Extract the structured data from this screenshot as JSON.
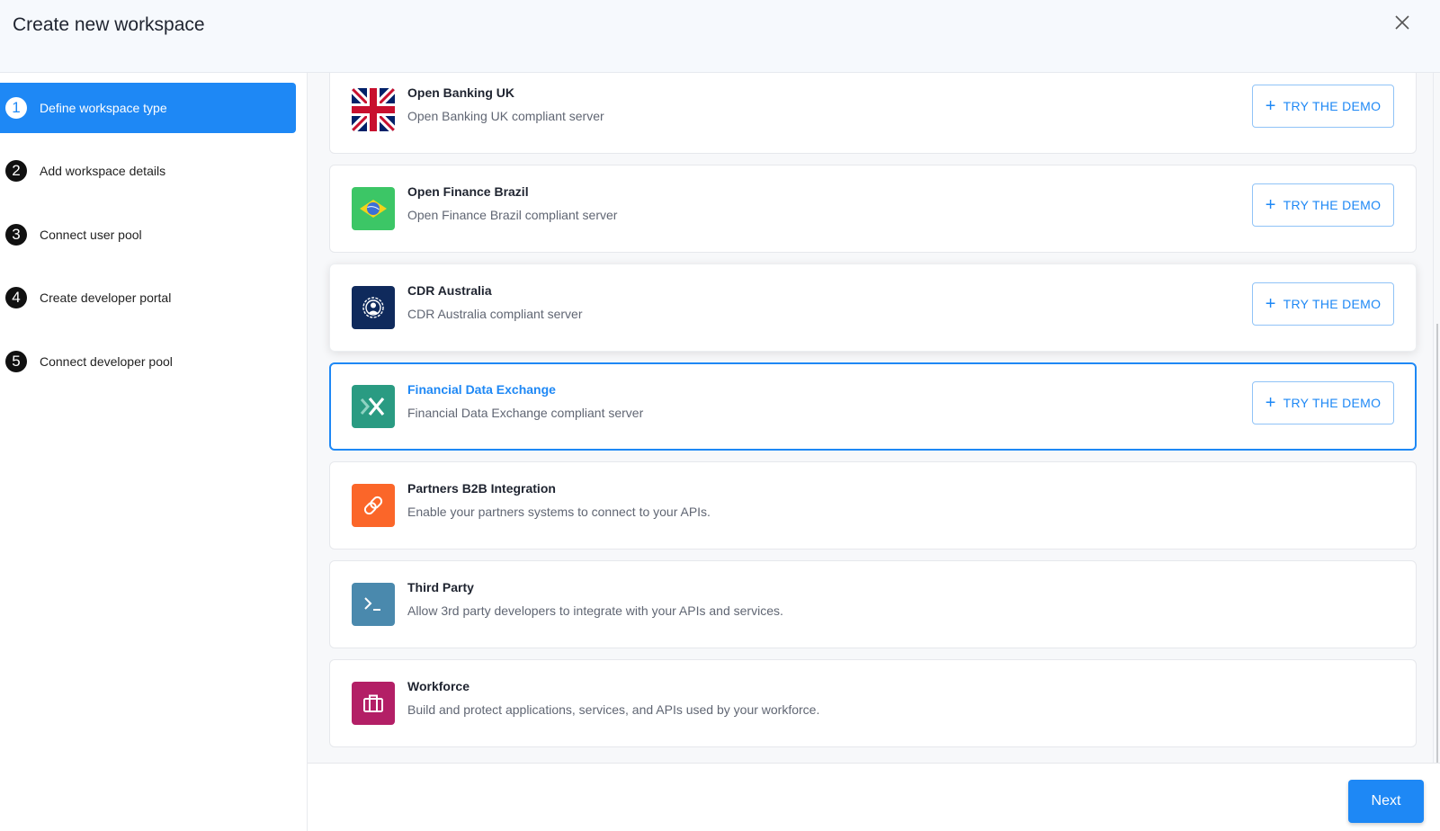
{
  "header": {
    "title": "Create new workspace",
    "close_icon": "close-icon"
  },
  "steps": [
    {
      "number": "1",
      "label": "Define workspace type",
      "active": true
    },
    {
      "number": "2",
      "label": "Add workspace details",
      "active": false
    },
    {
      "number": "3",
      "label": "Connect user pool",
      "active": false
    },
    {
      "number": "4",
      "label": "Create developer portal",
      "active": false
    },
    {
      "number": "5",
      "label": "Connect developer pool",
      "active": false
    }
  ],
  "workspace_types": [
    {
      "name": "Open Banking UK",
      "description": "Open Banking UK compliant server",
      "icon": "uk-flag-icon",
      "demo_label": "TRY THE DEMO",
      "has_demo": true
    },
    {
      "name": "Open Finance Brazil",
      "description": "Open Finance Brazil compliant server",
      "icon": "brazil-flag-icon",
      "demo_label": "TRY THE DEMO",
      "has_demo": true
    },
    {
      "name": "CDR Australia",
      "description": "CDR Australia compliant server",
      "icon": "cdr-australia-icon",
      "demo_label": "TRY THE DEMO",
      "has_demo": true,
      "hovered": true
    },
    {
      "name": "Financial Data Exchange",
      "description": "Financial Data Exchange compliant server",
      "icon": "fdx-icon",
      "demo_label": "TRY THE DEMO",
      "has_demo": true,
      "selected": true
    },
    {
      "name": "Partners B2B Integration",
      "description": "Enable your partners systems to connect to your APIs.",
      "icon": "link-icon",
      "has_demo": false
    },
    {
      "name": "Third Party",
      "description": "Allow 3rd party developers to integrate with your APIs and services.",
      "icon": "terminal-icon",
      "has_demo": false
    },
    {
      "name": "Workforce",
      "description": "Build and protect applications, services, and APIs used by your workforce.",
      "icon": "briefcase-icon",
      "has_demo": false
    }
  ],
  "colors": {
    "accent": "#1e88f5",
    "cdr_bg": "#0f2a5c",
    "fdx_bg": "#2a9b82",
    "partners_bg": "#fb6629",
    "third_party_bg": "#4a89ad",
    "workforce_bg": "#b31f66",
    "brazil_bg": "#3cc666"
  },
  "footer": {
    "next_label": "Next"
  }
}
